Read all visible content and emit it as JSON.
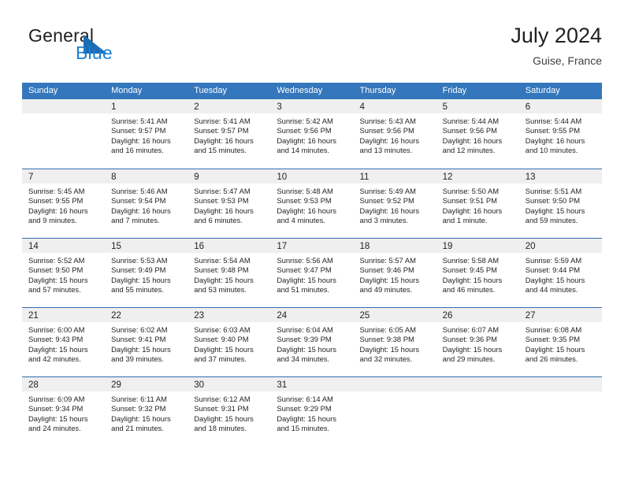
{
  "brand": {
    "name_part1": "General",
    "name_part2": "Blue",
    "mark": "triangle-flag-icon"
  },
  "header": {
    "title": "July 2024",
    "subtitle": "Guise, France"
  },
  "calendar": {
    "weekdays": [
      "Sunday",
      "Monday",
      "Tuesday",
      "Wednesday",
      "Thursday",
      "Friday",
      "Saturday"
    ],
    "colors": {
      "header_blue": "#3477bc",
      "row_rule_blue": "#2f6fb0",
      "day_band_gray": "#efefef",
      "brand_blue": "#1b7fd4",
      "text": "#231f20"
    },
    "weeks": [
      [
        {
          "day": "",
          "sunrise": "",
          "sunset": "",
          "daylight_line1": "",
          "daylight_line2": ""
        },
        {
          "day": "1",
          "sunrise": "Sunrise: 5:41 AM",
          "sunset": "Sunset: 9:57 PM",
          "daylight_line1": "Daylight: 16 hours",
          "daylight_line2": "and 16 minutes."
        },
        {
          "day": "2",
          "sunrise": "Sunrise: 5:41 AM",
          "sunset": "Sunset: 9:57 PM",
          "daylight_line1": "Daylight: 16 hours",
          "daylight_line2": "and 15 minutes."
        },
        {
          "day": "3",
          "sunrise": "Sunrise: 5:42 AM",
          "sunset": "Sunset: 9:56 PM",
          "daylight_line1": "Daylight: 16 hours",
          "daylight_line2": "and 14 minutes."
        },
        {
          "day": "4",
          "sunrise": "Sunrise: 5:43 AM",
          "sunset": "Sunset: 9:56 PM",
          "daylight_line1": "Daylight: 16 hours",
          "daylight_line2": "and 13 minutes."
        },
        {
          "day": "5",
          "sunrise": "Sunrise: 5:44 AM",
          "sunset": "Sunset: 9:56 PM",
          "daylight_line1": "Daylight: 16 hours",
          "daylight_line2": "and 12 minutes."
        },
        {
          "day": "6",
          "sunrise": "Sunrise: 5:44 AM",
          "sunset": "Sunset: 9:55 PM",
          "daylight_line1": "Daylight: 16 hours",
          "daylight_line2": "and 10 minutes."
        }
      ],
      [
        {
          "day": "7",
          "sunrise": "Sunrise: 5:45 AM",
          "sunset": "Sunset: 9:55 PM",
          "daylight_line1": "Daylight: 16 hours",
          "daylight_line2": "and 9 minutes."
        },
        {
          "day": "8",
          "sunrise": "Sunrise: 5:46 AM",
          "sunset": "Sunset: 9:54 PM",
          "daylight_line1": "Daylight: 16 hours",
          "daylight_line2": "and 7 minutes."
        },
        {
          "day": "9",
          "sunrise": "Sunrise: 5:47 AM",
          "sunset": "Sunset: 9:53 PM",
          "daylight_line1": "Daylight: 16 hours",
          "daylight_line2": "and 6 minutes."
        },
        {
          "day": "10",
          "sunrise": "Sunrise: 5:48 AM",
          "sunset": "Sunset: 9:53 PM",
          "daylight_line1": "Daylight: 16 hours",
          "daylight_line2": "and 4 minutes."
        },
        {
          "day": "11",
          "sunrise": "Sunrise: 5:49 AM",
          "sunset": "Sunset: 9:52 PM",
          "daylight_line1": "Daylight: 16 hours",
          "daylight_line2": "and 3 minutes."
        },
        {
          "day": "12",
          "sunrise": "Sunrise: 5:50 AM",
          "sunset": "Sunset: 9:51 PM",
          "daylight_line1": "Daylight: 16 hours",
          "daylight_line2": "and 1 minute."
        },
        {
          "day": "13",
          "sunrise": "Sunrise: 5:51 AM",
          "sunset": "Sunset: 9:50 PM",
          "daylight_line1": "Daylight: 15 hours",
          "daylight_line2": "and 59 minutes."
        }
      ],
      [
        {
          "day": "14",
          "sunrise": "Sunrise: 5:52 AM",
          "sunset": "Sunset: 9:50 PM",
          "daylight_line1": "Daylight: 15 hours",
          "daylight_line2": "and 57 minutes."
        },
        {
          "day": "15",
          "sunrise": "Sunrise: 5:53 AM",
          "sunset": "Sunset: 9:49 PM",
          "daylight_line1": "Daylight: 15 hours",
          "daylight_line2": "and 55 minutes."
        },
        {
          "day": "16",
          "sunrise": "Sunrise: 5:54 AM",
          "sunset": "Sunset: 9:48 PM",
          "daylight_line1": "Daylight: 15 hours",
          "daylight_line2": "and 53 minutes."
        },
        {
          "day": "17",
          "sunrise": "Sunrise: 5:56 AM",
          "sunset": "Sunset: 9:47 PM",
          "daylight_line1": "Daylight: 15 hours",
          "daylight_line2": "and 51 minutes."
        },
        {
          "day": "18",
          "sunrise": "Sunrise: 5:57 AM",
          "sunset": "Sunset: 9:46 PM",
          "daylight_line1": "Daylight: 15 hours",
          "daylight_line2": "and 49 minutes."
        },
        {
          "day": "19",
          "sunrise": "Sunrise: 5:58 AM",
          "sunset": "Sunset: 9:45 PM",
          "daylight_line1": "Daylight: 15 hours",
          "daylight_line2": "and 46 minutes."
        },
        {
          "day": "20",
          "sunrise": "Sunrise: 5:59 AM",
          "sunset": "Sunset: 9:44 PM",
          "daylight_line1": "Daylight: 15 hours",
          "daylight_line2": "and 44 minutes."
        }
      ],
      [
        {
          "day": "21",
          "sunrise": "Sunrise: 6:00 AM",
          "sunset": "Sunset: 9:43 PM",
          "daylight_line1": "Daylight: 15 hours",
          "daylight_line2": "and 42 minutes."
        },
        {
          "day": "22",
          "sunrise": "Sunrise: 6:02 AM",
          "sunset": "Sunset: 9:41 PM",
          "daylight_line1": "Daylight: 15 hours",
          "daylight_line2": "and 39 minutes."
        },
        {
          "day": "23",
          "sunrise": "Sunrise: 6:03 AM",
          "sunset": "Sunset: 9:40 PM",
          "daylight_line1": "Daylight: 15 hours",
          "daylight_line2": "and 37 minutes."
        },
        {
          "day": "24",
          "sunrise": "Sunrise: 6:04 AM",
          "sunset": "Sunset: 9:39 PM",
          "daylight_line1": "Daylight: 15 hours",
          "daylight_line2": "and 34 minutes."
        },
        {
          "day": "25",
          "sunrise": "Sunrise: 6:05 AM",
          "sunset": "Sunset: 9:38 PM",
          "daylight_line1": "Daylight: 15 hours",
          "daylight_line2": "and 32 minutes."
        },
        {
          "day": "26",
          "sunrise": "Sunrise: 6:07 AM",
          "sunset": "Sunset: 9:36 PM",
          "daylight_line1": "Daylight: 15 hours",
          "daylight_line2": "and 29 minutes."
        },
        {
          "day": "27",
          "sunrise": "Sunrise: 6:08 AM",
          "sunset": "Sunset: 9:35 PM",
          "daylight_line1": "Daylight: 15 hours",
          "daylight_line2": "and 26 minutes."
        }
      ],
      [
        {
          "day": "28",
          "sunrise": "Sunrise: 6:09 AM",
          "sunset": "Sunset: 9:34 PM",
          "daylight_line1": "Daylight: 15 hours",
          "daylight_line2": "and 24 minutes."
        },
        {
          "day": "29",
          "sunrise": "Sunrise: 6:11 AM",
          "sunset": "Sunset: 9:32 PM",
          "daylight_line1": "Daylight: 15 hours",
          "daylight_line2": "and 21 minutes."
        },
        {
          "day": "30",
          "sunrise": "Sunrise: 6:12 AM",
          "sunset": "Sunset: 9:31 PM",
          "daylight_line1": "Daylight: 15 hours",
          "daylight_line2": "and 18 minutes."
        },
        {
          "day": "31",
          "sunrise": "Sunrise: 6:14 AM",
          "sunset": "Sunset: 9:29 PM",
          "daylight_line1": "Daylight: 15 hours",
          "daylight_line2": "and 15 minutes."
        },
        {
          "day": "",
          "sunrise": "",
          "sunset": "",
          "daylight_line1": "",
          "daylight_line2": ""
        },
        {
          "day": "",
          "sunrise": "",
          "sunset": "",
          "daylight_line1": "",
          "daylight_line2": ""
        },
        {
          "day": "",
          "sunrise": "",
          "sunset": "",
          "daylight_line1": "",
          "daylight_line2": ""
        }
      ]
    ]
  }
}
